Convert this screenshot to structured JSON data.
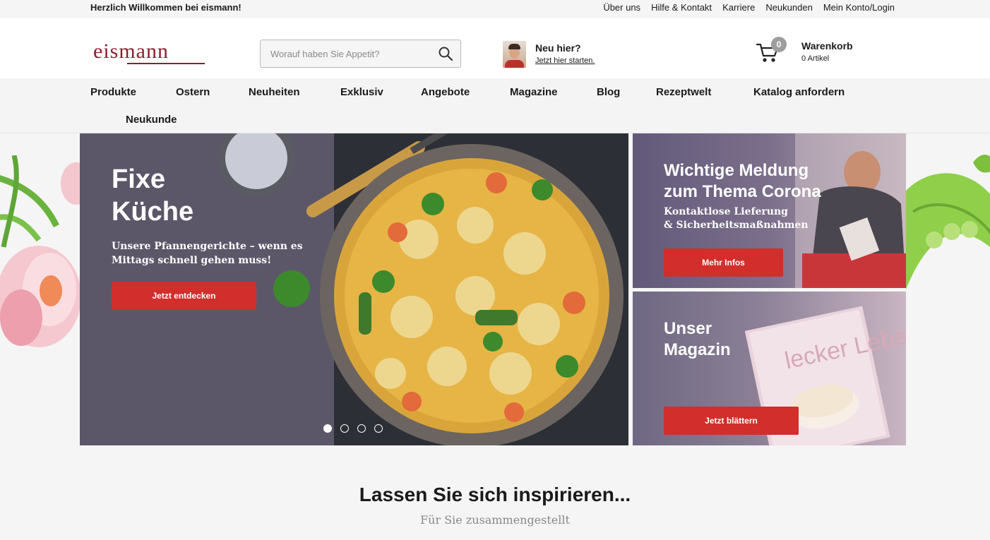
{
  "topbar": {
    "welcome": "Herzlich Willkommen bei eismann!",
    "links": [
      "Über uns",
      "Hilfe & Kontakt",
      "Karriere",
      "Neukunden",
      "Mein Konto/Login"
    ]
  },
  "header": {
    "logo_text": "eismann",
    "search_placeholder": "Worauf haben Sie Appetit?",
    "newhere_title": "Neu hier?",
    "newhere_link": "Jetzt hier starten.",
    "cart_title": "Warenkorb",
    "cart_count": "0 Artikel",
    "cart_badge": "0"
  },
  "nav": {
    "items": [
      "Produkte",
      "Ostern",
      "Neuheiten",
      "Exklusiv",
      "Angebote",
      "Magazine",
      "Blog",
      "Rezeptwelt",
      "Katalog anfordern",
      "Neukunde"
    ]
  },
  "hero": {
    "title": "Fixe\nKüche",
    "subtitle": "Unsere Pfannengerichte – wenn es Mittags schnell gehen muss!",
    "button": "Jetzt entdecken",
    "slides": 4,
    "active_slide": 1
  },
  "card_corona": {
    "title": "Wichtige Meldung\nzum Thema Corona",
    "subtitle": "Kontaktlose Lieferung\n & Sicherheitsmaßnahmen",
    "button": "Mehr Infos"
  },
  "card_magazin": {
    "title": "Unser\nMagazin",
    "button": "Jetzt blättern",
    "magazine_cover_text": "lecker Leben"
  },
  "inspire": {
    "title": "Lassen Sie sich inspirieren...",
    "subtitle": "Für Sie zusammengestellt"
  },
  "colors": {
    "brand": "#8b1f2c",
    "button_red": "#d12e2c"
  }
}
